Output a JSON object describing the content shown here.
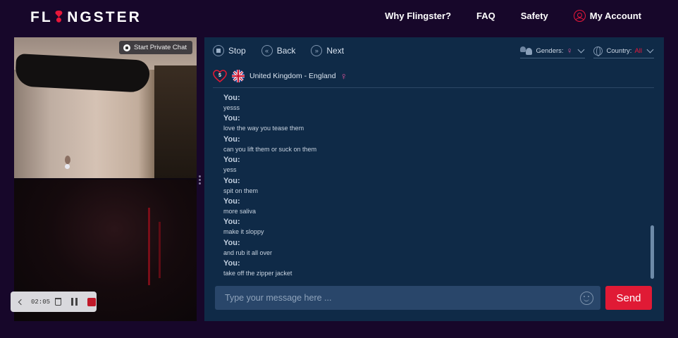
{
  "header": {
    "logo_prefix": "FL",
    "logo_suffix": "NGSTER",
    "nav": [
      "Why Flingster?",
      "FAQ",
      "Safety",
      "My Account"
    ]
  },
  "video": {
    "private_chat_label": "Start Private Chat",
    "recording_time": "02:05"
  },
  "toolbar": {
    "stop": "Stop",
    "back": "Back",
    "next": "Next"
  },
  "filters": {
    "genders_label": "Genders:",
    "country_label": "Country:",
    "country_value": "All"
  },
  "partner": {
    "hearts": "5",
    "location": "United Kingdom - England"
  },
  "messages": [
    {
      "sender": "You:",
      "text": "yesss"
    },
    {
      "sender": "You:",
      "text": "love the way you tease them"
    },
    {
      "sender": "You:",
      "text": "can you lift them or suck on them"
    },
    {
      "sender": "You:",
      "text": "yess"
    },
    {
      "sender": "You:",
      "text": "spit on them"
    },
    {
      "sender": "You:",
      "text": "more saliva"
    },
    {
      "sender": "You:",
      "text": "make it sloppy"
    },
    {
      "sender": "You:",
      "text": "and rub it all over"
    },
    {
      "sender": "You:",
      "text": "take off the zipper jacket"
    }
  ],
  "composer": {
    "placeholder": "Type your message here ...",
    "send_label": "Send"
  },
  "colors": {
    "accent": "#e01a35",
    "panel": "#0f2a47",
    "background": "#17072a",
    "female": "#e0559a"
  }
}
